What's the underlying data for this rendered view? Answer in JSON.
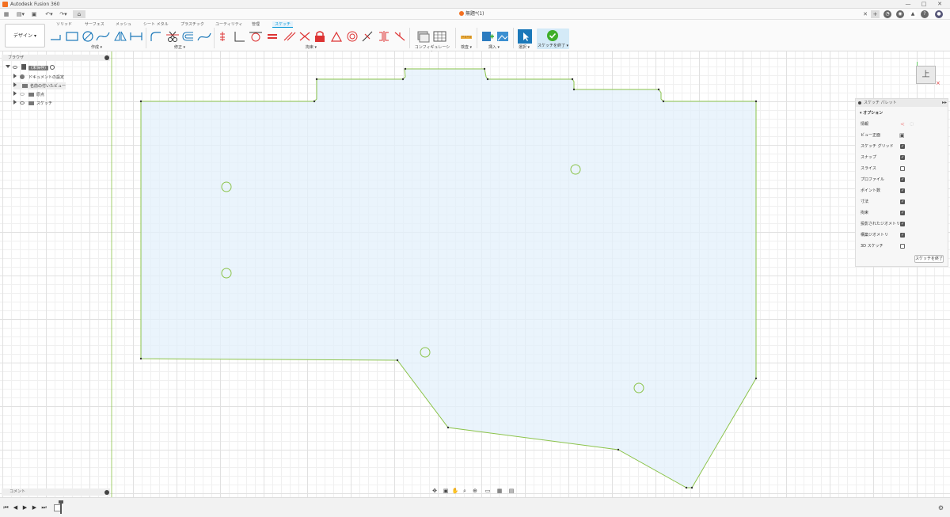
{
  "app": {
    "title": "Autodesk Fusion 360",
    "document_tab": "無題*(1)"
  },
  "window_controls": [
    "—",
    "□",
    "✕"
  ],
  "toolbar": {
    "workspace": "デザイン ▾",
    "tabs": [
      "ソリッド",
      "サーフェス",
      "メッシュ",
      "シート メタル",
      "プラスチック",
      "ユーティリティ",
      "管理",
      "スケッチ"
    ],
    "active_tab": "スケッチ",
    "groups": {
      "create": "作成 ▾",
      "modify": "修正 ▾",
      "constraints": "拘束 ▾",
      "configure": "コンフィギュレーション ▾",
      "inspect": "検査 ▾",
      "insert": "挿入 ▾",
      "select": "選択 ▾",
      "finish": "スケッチを終了 ▾"
    }
  },
  "browser": {
    "header": "ブラウザ",
    "root": "(未保存)",
    "items": [
      "ドキュメントの設定",
      "名前の付いたビュー",
      "原点",
      "スケッチ"
    ]
  },
  "comments": {
    "label": "コメント"
  },
  "palette": {
    "header": "スケッチ パレット",
    "section": "オプション",
    "rows": [
      {
        "label": "情報",
        "kind": "icons"
      },
      {
        "label": "ビュー正面",
        "kind": "icon"
      },
      {
        "label": "スケッチ グリッド",
        "checked": true
      },
      {
        "label": "スナップ",
        "checked": true
      },
      {
        "label": "スライス",
        "checked": false
      },
      {
        "label": "プロファイル",
        "checked": true
      },
      {
        "label": "ポイント数",
        "checked": true
      },
      {
        "label": "寸法",
        "checked": true
      },
      {
        "label": "拘束",
        "checked": true
      },
      {
        "label": "投影されたジオメトリ",
        "checked": true
      },
      {
        "label": "構築ジオメトリ",
        "checked": true
      },
      {
        "label": "3D スケッチ",
        "checked": false
      }
    ],
    "finish_button": "スケッチを終了"
  },
  "viewcube": {
    "face": "上"
  },
  "colors": {
    "sketch_line": "#8bc34a",
    "profile_fill": "#e3f0fb",
    "accent": "#0696d7"
  }
}
